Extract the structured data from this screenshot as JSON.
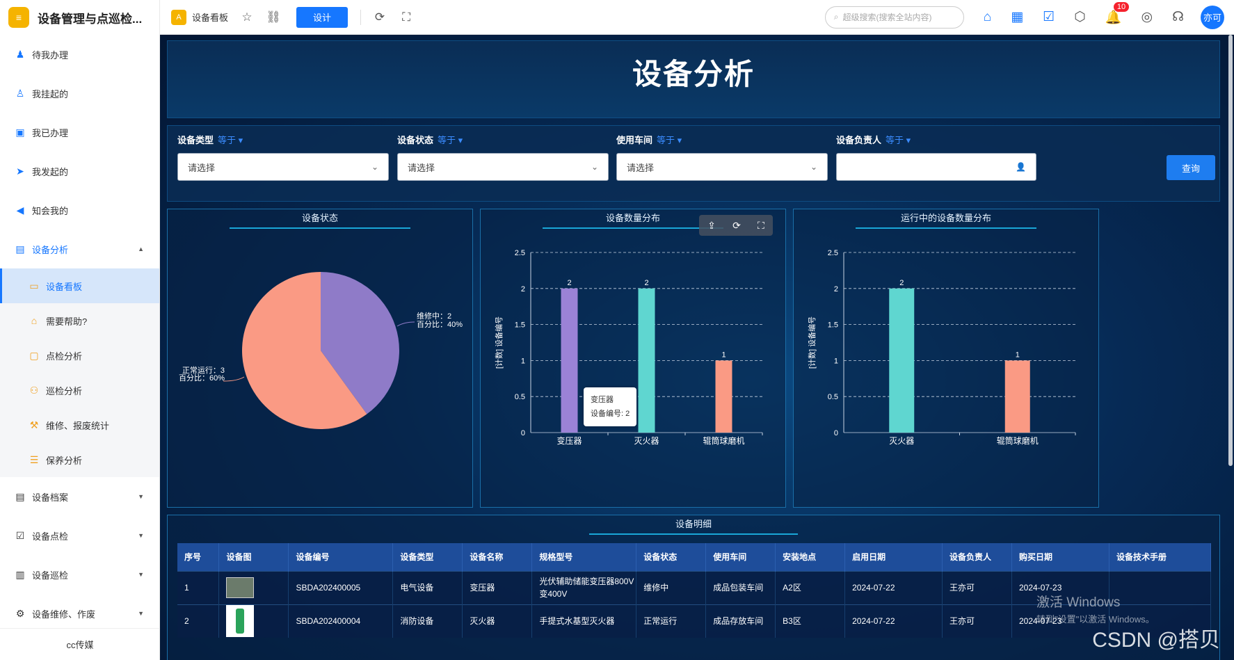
{
  "app": {
    "title": "设备管理与点巡检...",
    "logo": "logo-icon"
  },
  "sidebar": {
    "items": [
      {
        "label": "待我办理",
        "icon": "user-icon"
      },
      {
        "label": "我挂起的",
        "icon": "user-pause-icon"
      },
      {
        "label": "我已办理",
        "icon": "check-doc-icon"
      },
      {
        "label": "我发起的",
        "icon": "send-icon"
      },
      {
        "label": "知会我的",
        "icon": "speaker-icon"
      }
    ],
    "open_group": {
      "label": "设备分析",
      "icon": "report-icon"
    },
    "sub_items": [
      {
        "label": "设备看板",
        "icon": "dashboard-icon"
      },
      {
        "label": "需要帮助?",
        "icon": "help-icon"
      },
      {
        "label": "点检分析",
        "icon": "monitor-icon"
      },
      {
        "label": "巡检分析",
        "icon": "people-icon"
      },
      {
        "label": "维修、报废统计",
        "icon": "wrench-icon"
      },
      {
        "label": "保养分析",
        "icon": "list-icon"
      }
    ],
    "groups": [
      {
        "label": "设备档案",
        "icon": "folder-icon"
      },
      {
        "label": "设备点检",
        "icon": "checklist-icon"
      },
      {
        "label": "设备巡检",
        "icon": "chart-icon"
      },
      {
        "label": "设备维修、作废",
        "icon": "repair-icon"
      }
    ],
    "footer": "cc传媒"
  },
  "topbar": {
    "tab_label": "设备看板",
    "design_label": "设计",
    "search_placeholder": "超级搜索(搜索全站内容)",
    "badge": "10",
    "avatar": "亦可"
  },
  "page": {
    "title": "设备分析"
  },
  "filters": [
    {
      "label": "设备类型",
      "op": "等于",
      "placeholder": "请选择"
    },
    {
      "label": "设备状态",
      "op": "等于",
      "placeholder": "请选择"
    },
    {
      "label": "使用车间",
      "op": "等于",
      "placeholder": "请选择"
    },
    {
      "label": "设备负责人",
      "op": "等于",
      "placeholder": ""
    }
  ],
  "query_label": "查询",
  "chart_data": [
    {
      "type": "pie",
      "title": "设备状态",
      "categories": [
        "维修中",
        "正常运行"
      ],
      "values": [
        2,
        3
      ],
      "percent": [
        "40%",
        "60%"
      ],
      "labels": [
        "维修中：2",
        "百分比：40%",
        "正常运行：3",
        "百分比：60%"
      ],
      "colors": [
        "#8f7bc8",
        "#fa9a84"
      ]
    },
    {
      "type": "bar",
      "title": "设备数量分布",
      "categories": [
        "变压器",
        "灭火器",
        "辊筒球磨机"
      ],
      "values": [
        2,
        2,
        1
      ],
      "ylabel": "[计数] 设备编号",
      "ylim": [
        0,
        2.5
      ],
      "yticks": [
        "0",
        "0.5",
        "1",
        "1.5",
        "2",
        "2.5"
      ],
      "colors": [
        "#9b82d6",
        "#5fd6d0",
        "#fa9a84"
      ],
      "tooltip": {
        "title": "变压器",
        "line": "设备编号: 2"
      }
    },
    {
      "type": "bar",
      "title": "运行中的设备数量分布",
      "categories": [
        "灭火器",
        "辊筒球磨机"
      ],
      "values": [
        2,
        1
      ],
      "ylabel": "[计数] 设备编号",
      "ylim": [
        0,
        2.5
      ],
      "yticks": [
        "0",
        "0.5",
        "1",
        "1.5",
        "2",
        "2.5"
      ],
      "colors": [
        "#5fd6d0",
        "#fa9a84"
      ]
    }
  ],
  "table": {
    "title": "设备明细",
    "headers": [
      "序号",
      "设备图",
      "设备编号",
      "设备类型",
      "设备名称",
      "规格型号",
      "设备状态",
      "使用车间",
      "安装地点",
      "启用日期",
      "设备负责人",
      "购买日期",
      "设备技术手册"
    ],
    "rows": [
      [
        "1",
        "",
        "SBDA202400005",
        "电气设备",
        "变压器",
        "光伏辅助储能变压器800V变400V",
        "维修中",
        "成品包装车间",
        "A2区",
        "2024-07-22",
        "王亦可",
        "2024-07-23",
        ""
      ],
      [
        "2",
        "",
        "SBDA202400004",
        "消防设备",
        "灭火器",
        "手提式水基型灭火器",
        "正常运行",
        "成品存放车间",
        "B3区",
        "2024-07-22",
        "王亦可",
        "2024-07-23",
        ""
      ]
    ]
  },
  "overlay": {
    "win_title": "激活 Windows",
    "win_sub": "转到\"设置\"以激活 Windows。",
    "watermark": "CSDN @搭贝"
  }
}
